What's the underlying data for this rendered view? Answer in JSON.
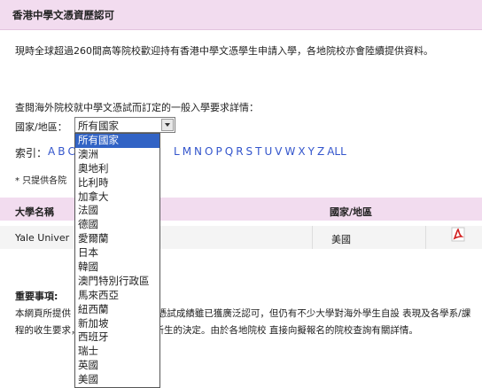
{
  "page": {
    "title": "香港中學文憑資歷認可",
    "intro": "現時全球超過260間高等院校歡迎持有香港中學文憑學生申請入學，各地院校亦會陸續提供資料。",
    "lookup": "查閱海外院校就中學文憑試而訂定的一般入學要求詳情：",
    "country_label": "國家/地區：",
    "index_label": "索引：",
    "note": "* 只提供各院",
    "notes_title": "重要事項:",
    "notes_body": "本網頁所提供                                     的資料只供參考。文憑試成績雖已獲廣泛認可，但仍有不少大學對海外學生自設                                     表現及各學系/課程的收生要求，均會影響大學取錄新生的決定。由於各地院校                                     直接向擬報名的院校查詢有關詳情。"
  },
  "index": {
    "first_letters": [
      "A",
      "B",
      "C"
    ],
    "letters": [
      "L",
      "M",
      "N",
      "O",
      "P",
      "Q",
      "R",
      "S",
      "T",
      "U",
      "V",
      "W",
      "X",
      "Y",
      "Z",
      "ALL"
    ]
  },
  "select": {
    "value": "所有國家",
    "options": [
      "所有國家",
      "澳洲",
      "奧地利",
      "比利時",
      "加拿大",
      "法國",
      "德國",
      "愛爾蘭",
      "日本",
      "韓國",
      "澳門特別行政區",
      "馬來西亞",
      "紐西蘭",
      "新加坡",
      "西班牙",
      "瑞士",
      "英國",
      "美國"
    ],
    "selected_index": 0
  },
  "table": {
    "headers": [
      "大學名稱",
      "國家/地區"
    ],
    "rows": [
      {
        "name": "Yale Univer",
        "country": "美國",
        "icon": "pdf-icon"
      }
    ]
  },
  "colors": {
    "header_band": "#f2dcef",
    "link": "#3355cc",
    "selection": "#3163c5"
  }
}
